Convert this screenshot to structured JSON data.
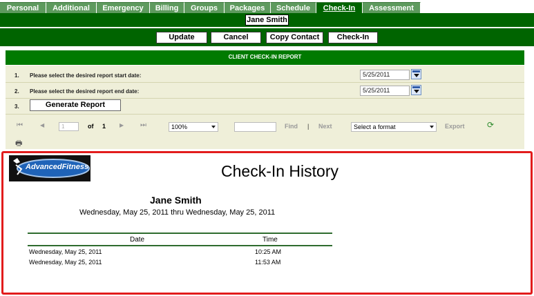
{
  "tabs": [
    {
      "label": "Personal",
      "active": false
    },
    {
      "label": "Additional",
      "active": false
    },
    {
      "label": "Emergency",
      "active": false
    },
    {
      "label": "Billing",
      "active": false
    },
    {
      "label": "Groups",
      "active": false
    },
    {
      "label": "Packages",
      "active": false
    },
    {
      "label": "Schedule",
      "active": false
    },
    {
      "label": "Check-In",
      "active": true
    },
    {
      "label": "Assessment",
      "active": false
    }
  ],
  "client_name": "Jane Smith",
  "actions": {
    "update": "Update",
    "cancel": "Cancel",
    "copy_contact": "Copy Contact",
    "check_in": "Check-In"
  },
  "report_panel": {
    "title": "CLIENT CHECK-IN REPORT",
    "row1": {
      "num": "1.",
      "label": "Please select the desired report start date:",
      "value": "5/25/2011"
    },
    "row2": {
      "num": "2.",
      "label": "Please select the desired report end date:",
      "value": "5/25/2011"
    },
    "row3": {
      "num": "3.",
      "button": "Generate Report"
    }
  },
  "toolbar": {
    "first": "⏮",
    "prev": "◀",
    "page": "1",
    "of": "of",
    "total": "1",
    "next_page": "▶",
    "last": "⏭",
    "zoom": "100%",
    "find": "Find",
    "sep": "|",
    "next": "Next",
    "format_placeholder": "Select a format",
    "export": "Export",
    "refresh": "⟳",
    "print": "🖶"
  },
  "report": {
    "logo_text": "AdvancedFitness",
    "title": "Check-In History",
    "client": "Jane Smith",
    "range": "Wednesday, May 25, 2011 thru Wednesday, May 25, 2011",
    "columns": {
      "date": "Date",
      "time": "Time"
    },
    "rows": [
      {
        "date": "Wednesday, May 25, 2011",
        "time": "10:25 AM"
      },
      {
        "date": "Wednesday, May 25, 2011",
        "time": "11:53 AM"
      }
    ]
  },
  "colors": {
    "brand_green": "#006400",
    "tab_green": "#5e9a5e",
    "panel_bg": "#efefd9",
    "highlight_red": "#e21c1c"
  }
}
